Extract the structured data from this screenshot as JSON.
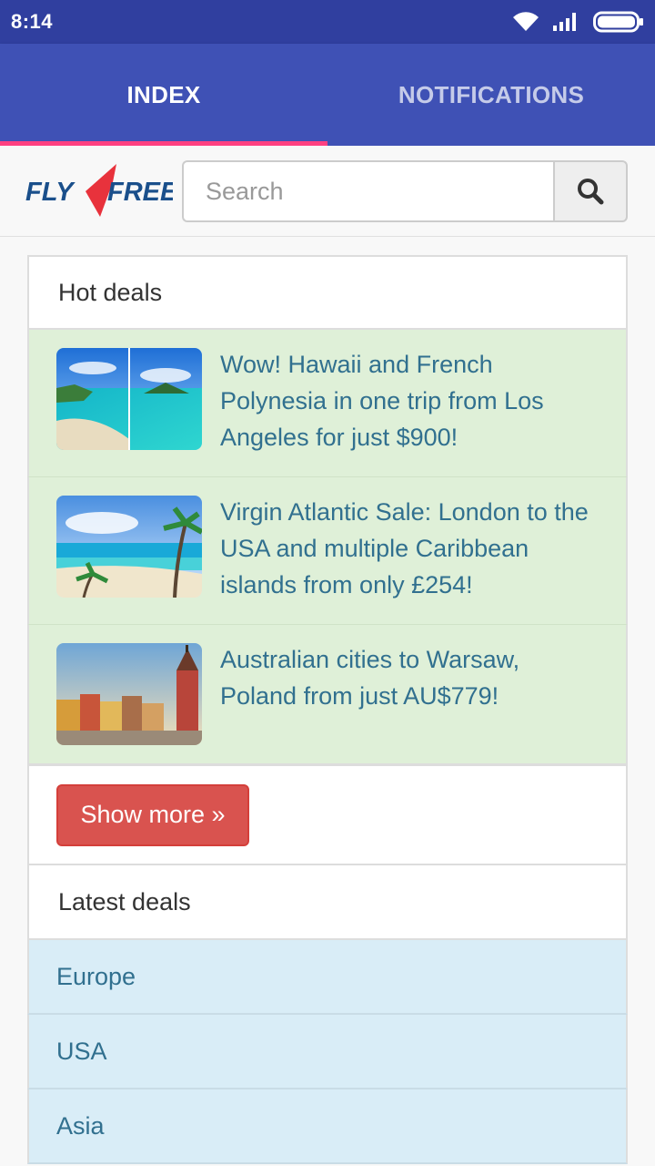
{
  "status_bar": {
    "time": "8:14",
    "icons": [
      "wifi-icon",
      "signal-icon",
      "battery-icon"
    ]
  },
  "tabs": [
    {
      "label": "INDEX",
      "active": true
    },
    {
      "label": "NOTIFICATIONS",
      "active": false
    }
  ],
  "header": {
    "logo_text_left": "FLY",
    "logo_text_right": "FREE",
    "search_placeholder": "Search",
    "search_icon": "search-icon"
  },
  "hot_deals": {
    "heading": "Hot deals",
    "items": [
      {
        "title": "Wow! Hawaii and French Polynesia in one trip from Los Angeles for just $900!",
        "image": "beach-photo"
      },
      {
        "title": "Virgin Atlantic Sale: London to the USA and multiple Caribbean islands from only £254!",
        "image": "caribbean-photo"
      },
      {
        "title": "Australian cities to Warsaw, Poland from just AU$779!",
        "image": "warsaw-photo"
      }
    ],
    "show_more_label": "Show more »"
  },
  "latest_deals": {
    "heading": "Latest deals",
    "regions": [
      "Europe",
      "USA",
      "Asia"
    ]
  },
  "colors": {
    "status_bar": "#303f9f",
    "app_bar": "#3f51b5",
    "tab_indicator": "#ff4081",
    "deal_bg": "#dff0d8",
    "deal_text": "#31708f",
    "region_bg": "#d9edf7",
    "button_red": "#d9534f",
    "logo_blue": "#1a4f8b",
    "logo_red": "#e8323c"
  }
}
